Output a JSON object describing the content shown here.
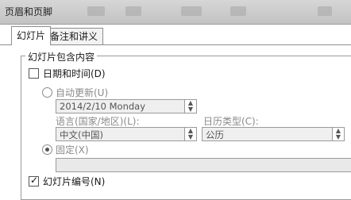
{
  "window": {
    "title": "页眉和页脚"
  },
  "tabs": [
    {
      "label": "幻灯片"
    },
    {
      "label": "备注和讲义"
    }
  ],
  "slide_group": {
    "legend": "幻灯片包含内容",
    "date_time": {
      "label": "日期和时间(D)",
      "checked": false
    },
    "auto_update": {
      "label": "自动更新(U)",
      "selected": false
    },
    "date_value": "2014/2/10 Monday",
    "language_label": "语言(国家/地区)(L):",
    "language_value": "中文(中国)",
    "calendar_label": "日历类型(C):",
    "calendar_value": "公历",
    "fixed": {
      "label": "固定(X)",
      "selected": true,
      "value": ""
    },
    "slide_number": {
      "label": "幻灯片编号(N)",
      "checked": true
    }
  }
}
